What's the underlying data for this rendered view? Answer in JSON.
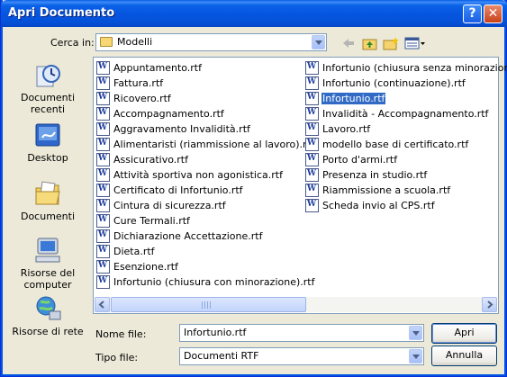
{
  "window": {
    "title": "Apri Documento"
  },
  "titlebar": {
    "help_label": "?",
    "close_label": "✕"
  },
  "lookin": {
    "label": "Cerca in:",
    "value": "Modelli"
  },
  "places": [
    {
      "label": "Documenti recenti",
      "icon": "recent-documents-icon"
    },
    {
      "label": "Desktop",
      "icon": "desktop-icon"
    },
    {
      "label": "Documenti",
      "icon": "my-documents-icon"
    },
    {
      "label": "Risorse del computer",
      "icon": "my-computer-icon"
    },
    {
      "label": "Risorse di rete",
      "icon": "network-places-icon"
    }
  ],
  "files": {
    "col1": [
      "Appuntamento.rtf",
      "Fattura.rtf",
      "Ricovero.rtf",
      "Accompagnamento.rtf",
      "Aggravamento Invalidità.rtf",
      "Alimentaristi (riammissione al lavoro).rtf",
      "Assicurativo.rtf",
      "Attività sportiva non agonistica.rtf",
      "Certificato di Infortunio.rtf",
      "Cintura di sicurezza.rtf",
      "Cure Termali.rtf",
      "Dichiarazione Accettazione.rtf",
      "Dieta.rtf",
      "Esenzione.rtf",
      "Infortunio (chiusura con minorazione).rtf"
    ],
    "col2": [
      "Infortunio (chiusura senza minorazione).",
      "Infortunio (continuazione).rtf",
      "Infortunio.rtf",
      "Invalidità - Accompagnamento.rtf",
      "Lavoro.rtf",
      "modello base di certificato.rtf",
      "Porto d'armi.rtf",
      "Presenza in studio.rtf",
      "Riammissione a scuola.rtf",
      "Scheda invio al CPS.rtf"
    ],
    "selected": "Infortunio.rtf"
  },
  "filename": {
    "label": "Nome file:",
    "value": "Infortunio.rtf"
  },
  "filetype": {
    "label": "Tipo file:",
    "value": "Documenti RTF"
  },
  "buttons": {
    "open": "Apri",
    "cancel": "Annulla"
  },
  "colors": {
    "titlebar": "#0054e3",
    "selection": "#316ac5",
    "dialog_bg": "#ece9d8"
  }
}
